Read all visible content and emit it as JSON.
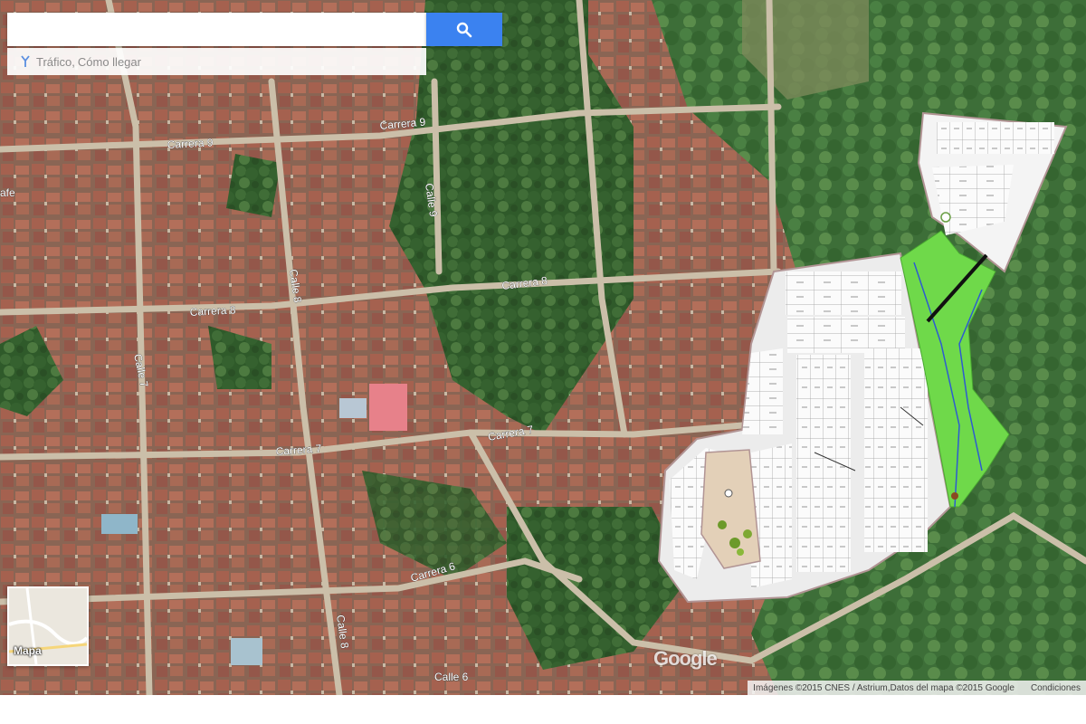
{
  "search": {
    "placeholder": "",
    "button_icon": "search-icon"
  },
  "subbar": {
    "icon": "traffic-icon",
    "traffic_label": "Tráfico",
    "separator": ",",
    "directions_label": "Cómo llegar"
  },
  "minimap": {
    "label": "Mapa"
  },
  "map": {
    "logo": "Google",
    "streets": [
      "Carrera 9",
      "Carrera 9",
      "Calle 9",
      "Carrera 8",
      "Carrera 8",
      "Calle 8",
      "Calle 7",
      "Carrera 7",
      "Carrera 7",
      "Carrera 6",
      "Calle 8",
      "Calle 6",
      "afe"
    ]
  },
  "footer": {
    "attribution": "Imágenes ©2015 CNES / Astrium,Datos del mapa ©2015 Google",
    "terms": "Condiciones"
  },
  "colors": {
    "search_button": "#3b82f0",
    "roofs": "#9c5a48",
    "vegetation": "#3f6a35",
    "plan_green": "#6fd94a"
  }
}
